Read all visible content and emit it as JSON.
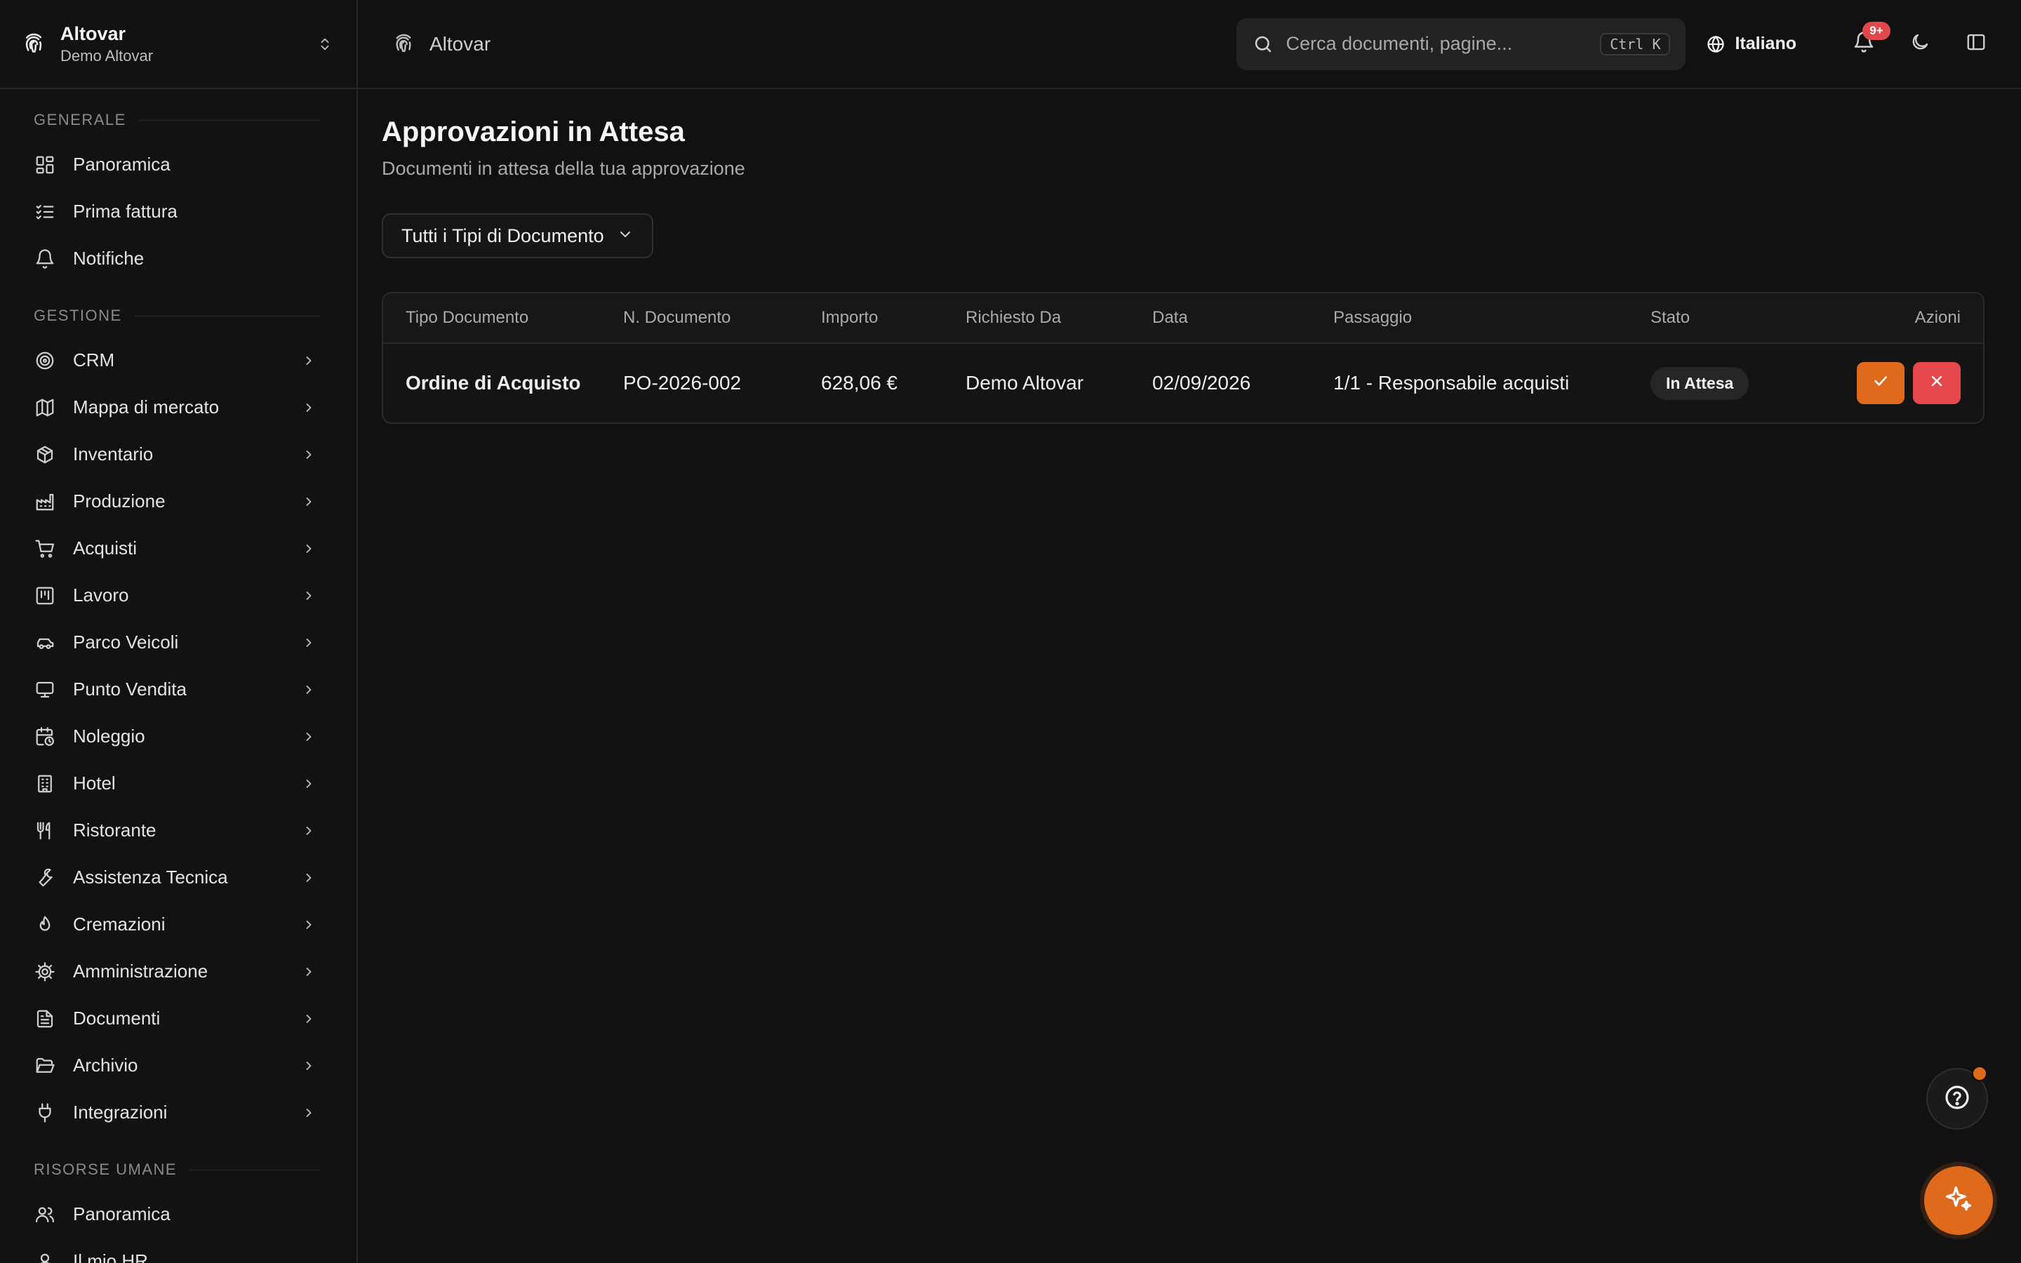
{
  "org": {
    "name": "Altovar",
    "subtitle": "Demo Altovar"
  },
  "breadcrumb": {
    "label": "Altovar"
  },
  "search": {
    "placeholder": "Cerca documenti, pagine...",
    "shortcut": "Ctrl K"
  },
  "language": {
    "label": "Italiano"
  },
  "notifications": {
    "badge": "9+"
  },
  "sidebar": {
    "sections": [
      {
        "title": "GENERALE",
        "items": [
          {
            "label": "Panoramica",
            "icon": "dashboard-icon",
            "chevron": false
          },
          {
            "label": "Prima fattura",
            "icon": "checklist-icon",
            "chevron": false
          },
          {
            "label": "Notifiche",
            "icon": "bell-icon",
            "chevron": false
          }
        ]
      },
      {
        "title": "GESTIONE",
        "items": [
          {
            "label": "CRM",
            "icon": "target-icon",
            "chevron": true
          },
          {
            "label": "Mappa di mercato",
            "icon": "map-icon",
            "chevron": true
          },
          {
            "label": "Inventario",
            "icon": "package-icon",
            "chevron": true
          },
          {
            "label": "Produzione",
            "icon": "factory-icon",
            "chevron": true
          },
          {
            "label": "Acquisti",
            "icon": "cart-icon",
            "chevron": true
          },
          {
            "label": "Lavoro",
            "icon": "kanban-icon",
            "chevron": true
          },
          {
            "label": "Parco Veicoli",
            "icon": "car-icon",
            "chevron": true
          },
          {
            "label": "Punto Vendita",
            "icon": "monitor-icon",
            "chevron": true
          },
          {
            "label": "Noleggio",
            "icon": "calendar-clock-icon",
            "chevron": true
          },
          {
            "label": "Hotel",
            "icon": "building-icon",
            "chevron": true
          },
          {
            "label": "Ristorante",
            "icon": "utensils-icon",
            "chevron": true
          },
          {
            "label": "Assistenza Tecnica",
            "icon": "wrench-icon",
            "chevron": true
          },
          {
            "label": "Cremazioni",
            "icon": "flame-icon",
            "chevron": true
          },
          {
            "label": "Amministrazione",
            "icon": "gear-icon",
            "chevron": true
          },
          {
            "label": "Documenti",
            "icon": "file-text-icon",
            "chevron": true
          },
          {
            "label": "Archivio",
            "icon": "folder-open-icon",
            "chevron": true
          },
          {
            "label": "Integrazioni",
            "icon": "plug-icon",
            "chevron": true
          }
        ]
      },
      {
        "title": "RISORSE UMANE",
        "items": [
          {
            "label": "Panoramica",
            "icon": "users-icon",
            "chevron": false
          },
          {
            "label": "Il mio HR",
            "icon": "user-icon",
            "chevron": false
          }
        ]
      }
    ]
  },
  "page": {
    "title": "Approvazioni in Attesa",
    "subtitle": "Documenti in attesa della tua approvazione",
    "filter": "Tutti i Tipi di Documento"
  },
  "table": {
    "headers": [
      "Tipo Documento",
      "N. Documento",
      "Importo",
      "Richiesto Da",
      "Data",
      "Passaggio",
      "Stato",
      "Azioni"
    ],
    "rows": [
      {
        "type": "Ordine di Acquisto",
        "number": "PO-2026-002",
        "amount": "628,06 €",
        "requested_by": "Demo Altovar",
        "date": "02/09/2026",
        "step": "1/1 - Responsabile acquisti",
        "status": "In Attesa"
      }
    ]
  },
  "colors": {
    "accent": "#e06a1b",
    "danger": "#e5484d",
    "background": "#111111"
  }
}
